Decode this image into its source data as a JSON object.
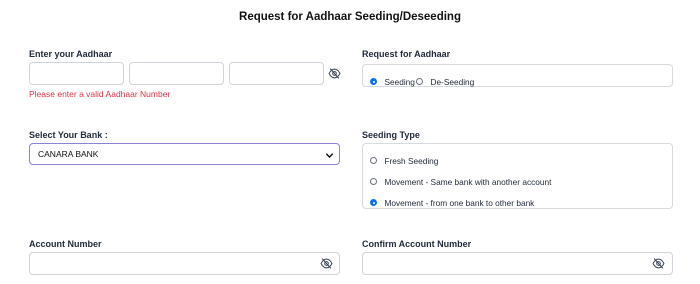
{
  "page": {
    "title": "Request for Aadhaar Seeding/Deseeding"
  },
  "aadhaar": {
    "label": "Enter your Aadhaar",
    "segments": [
      "",
      "",
      ""
    ],
    "error": "Please enter a valid Aadhaar Number"
  },
  "request": {
    "label": "Request for Aadhaar",
    "options": [
      {
        "label": "Seeding",
        "selected": true
      },
      {
        "label": "De-Seeding",
        "selected": false
      }
    ]
  },
  "bank": {
    "label": "Select Your Bank :",
    "selected": "CANARA BANK"
  },
  "seeding_type": {
    "label": "Seeding Type",
    "options": [
      {
        "label": "Fresh Seeding",
        "selected": false
      },
      {
        "label": "Movement - Same bank with another account",
        "selected": false
      },
      {
        "label": "Movement - from one bank to other bank",
        "selected": true
      }
    ]
  },
  "account": {
    "label": "Account Number",
    "value": ""
  },
  "confirm_account": {
    "label": "Confirm Account Number",
    "value": ""
  },
  "colors": {
    "accent": "#0d6efd",
    "error": "#dc3545",
    "select_border": "#8c82d6"
  },
  "icons": {
    "visibility_toggle": "eye-off-icon",
    "dropdown": "chevron-down-icon"
  }
}
